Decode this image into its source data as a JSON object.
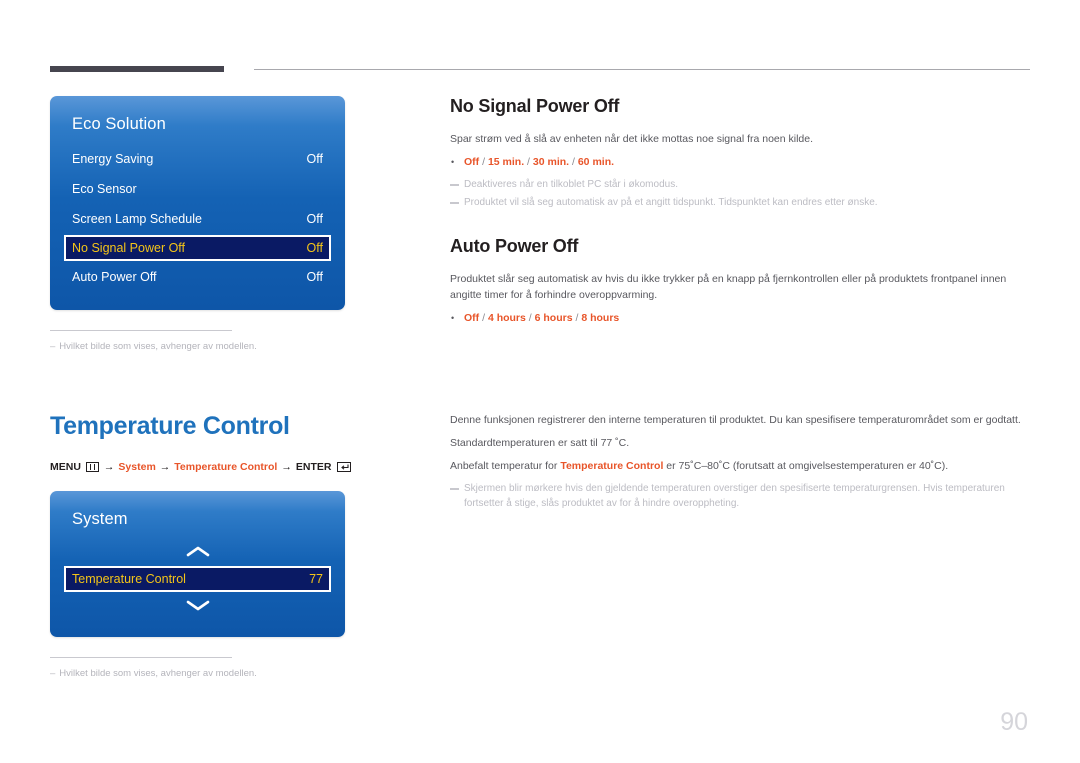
{
  "page": {
    "number": "90"
  },
  "eco_panel": {
    "title": "Eco Solution",
    "rows": [
      {
        "label": "Energy Saving",
        "value": "Off"
      },
      {
        "label": "Eco Sensor",
        "value": ""
      },
      {
        "label": "Screen Lamp Schedule",
        "value": "Off"
      },
      {
        "label": "No Signal Power Off",
        "value": "Off"
      },
      {
        "label": "Auto Power Off",
        "value": "Off"
      }
    ],
    "selected_index": 3,
    "note": "Hvilket bilde som vises, avhenger av modellen."
  },
  "system_panel": {
    "title": "System",
    "row": {
      "label": "Temperature Control",
      "value": "77"
    },
    "chevron_up": "chevron-up-icon",
    "chevron_down": "chevron-down-icon",
    "note": "Hvilket bilde som vises, avhenger av modellen."
  },
  "no_signal": {
    "title": "No Signal Power Off",
    "body": "Spar strøm ved å slå av enheten når det ikke mottas noe signal fra noen kilde.",
    "options": {
      "o1": "Off",
      "o2": "15 min.",
      "o3": "30 min.",
      "o4": "60 min."
    },
    "note1": "Deaktiveres når en tilkoblet PC står i økomodus.",
    "note2": "Produktet vil slå seg automatisk av på et angitt tidspunkt. Tidspunktet kan endres etter ønske."
  },
  "auto_power_off": {
    "title": "Auto Power Off",
    "body": "Produktet slår seg automatisk av hvis du ikke trykker på en knapp på fjernkontrollen eller på produktets frontpanel innen angitte timer for å forhindre overoppvarming.",
    "options": {
      "o1": "Off",
      "o2": "4 hours",
      "o3": "6 hours",
      "o4": "8 hours"
    }
  },
  "temperature_control": {
    "title": "Temperature Control",
    "menu_path": {
      "menu_label": "MENU",
      "menu_icon": "menu-bars-icon",
      "arrow": "→",
      "link1": "System",
      "link2": "Temperature Control",
      "enter_label": "ENTER",
      "enter_icon": "enter-arrow-icon"
    },
    "body1": "Denne funksjonen registrerer den interne temperaturen til produktet. Du kan spesifisere temperaturområdet som er godtatt.",
    "body2": "Standardtemperaturen er satt til 77 ˚C.",
    "body3_pre": "Anbefalt temperatur for ",
    "body3_em": "Temperature Control",
    "body3_post": " er 75˚C–80˚C (forutsatt at omgivelsestemperaturen er 40˚C).",
    "note": "Skjermen blir mørkere hvis den gjeldende temperaturen overstiger den spesifiserte temperaturgrensen. Hvis temperaturen fortsetter å stige, slås produktet av for å hindre overoppheting."
  },
  "colors": {
    "accent_orange": "#e8552a",
    "title_blue": "#1f72bc",
    "osd_blue": "#1462b4",
    "osd_selected_bg": "#0a1a64",
    "osd_selected_text": "#f5c518"
  }
}
